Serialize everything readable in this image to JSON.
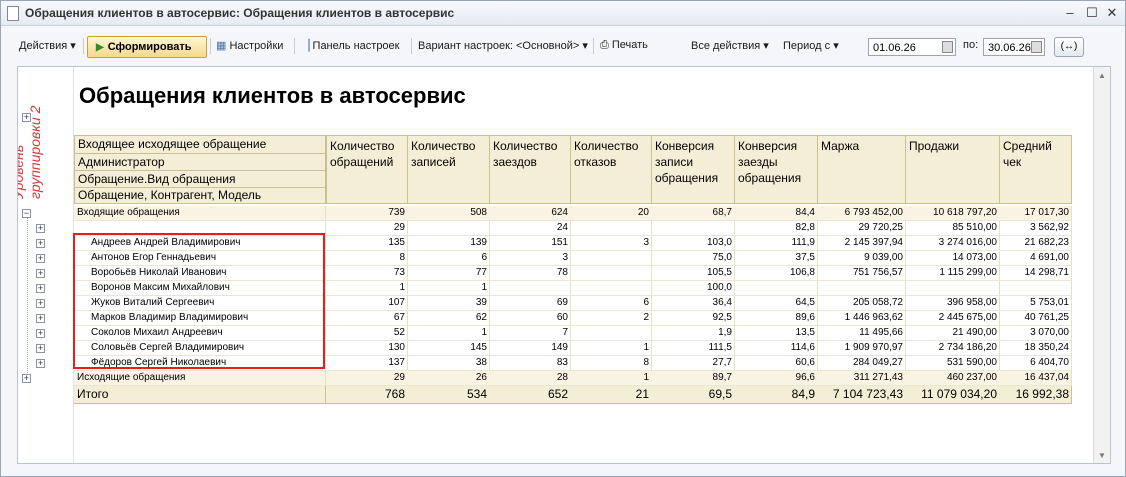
{
  "window": {
    "title": "Обращения клиентов в автосервис: Обращения клиентов в автосервис"
  },
  "toolbar": {
    "actions": "Действия",
    "form": "Сформировать",
    "settings": "Настройки",
    "panel": "Панель настроек",
    "variant": "Вариант настроек: <Основной>",
    "print": "Печать",
    "all_actions": "Все действия",
    "period": "Период с",
    "date_from": "01.06.26",
    "to": "по:",
    "date_to": "30.06.26"
  },
  "report": {
    "title": "Обращения клиентов в автосервис",
    "annotation_line1": "Уровень",
    "annotation_line2": "группировки 2",
    "row_headers": [
      "Входящее исходящее обращение",
      "Администратор",
      "Обращение.Вид обращения",
      "Обращение, Контрагент, Модель"
    ],
    "columns": [
      "Количество обращений",
      "Количество записей",
      "Количество заездов",
      "Количество отказов",
      "Конверсия записи обращения",
      "Конверсия заезды обращения",
      "Маржа",
      "Продажи",
      "Средний чек"
    ],
    "rows": [
      {
        "name": "Входящие обращения",
        "vals": [
          "739",
          "508",
          "624",
          "20",
          "68,7",
          "84,4",
          "6 793 452,00",
          "10 618 797,20",
          "17 017,30"
        ]
      },
      {
        "name": "",
        "vals": [
          "29",
          "",
          "24",
          "",
          "",
          "82,8",
          "29 720,25",
          "85 510,00",
          "3 562,92"
        ]
      },
      {
        "name": "Андреев Андрей Владимирович",
        "vals": [
          "135",
          "139",
          "151",
          "3",
          "103,0",
          "111,9",
          "2 145 397,94",
          "3 274 016,00",
          "21 682,23"
        ]
      },
      {
        "name": "Антонов Егор Геннадьевич",
        "vals": [
          "8",
          "6",
          "3",
          "",
          "75,0",
          "37,5",
          "9 039,00",
          "14 073,00",
          "4 691,00"
        ]
      },
      {
        "name": "Воробьёв Николай Иванович",
        "vals": [
          "73",
          "77",
          "78",
          "",
          "105,5",
          "106,8",
          "751 756,57",
          "1 115 299,00",
          "14 298,71"
        ]
      },
      {
        "name": "Воронов Максим Михайлович",
        "vals": [
          "1",
          "1",
          "",
          "",
          "100,0",
          "",
          "",
          "",
          ""
        ]
      },
      {
        "name": "Жуков Виталий Сергеевич",
        "vals": [
          "107",
          "39",
          "69",
          "6",
          "36,4",
          "64,5",
          "205 058,72",
          "396 958,00",
          "5 753,01"
        ]
      },
      {
        "name": "Марков Владимир Владимирович",
        "vals": [
          "67",
          "62",
          "60",
          "2",
          "92,5",
          "89,6",
          "1 446 963,62",
          "2 445 675,00",
          "40 761,25"
        ]
      },
      {
        "name": "Соколов Михаил Андреевич",
        "vals": [
          "52",
          "1",
          "7",
          "",
          "1,9",
          "13,5",
          "11 495,66",
          "21 490,00",
          "3 070,00"
        ]
      },
      {
        "name": "Соловьёв Сергей Владимирович",
        "vals": [
          "130",
          "145",
          "149",
          "1",
          "111,5",
          "114,6",
          "1 909 970,97",
          "2 734 186,20",
          "18 350,24"
        ]
      },
      {
        "name": "Фёдоров Сергей Николаевич",
        "vals": [
          "137",
          "38",
          "83",
          "8",
          "27,7",
          "60,6",
          "284 049,27",
          "531 590,00",
          "6 404,70"
        ]
      },
      {
        "name": "Исходящие обращения",
        "vals": [
          "29",
          "26",
          "28",
          "1",
          "89,7",
          "96,6",
          "311 271,43",
          "460 237,00",
          "16 437,04"
        ]
      }
    ],
    "total": {
      "name": "Итого",
      "vals": [
        "768",
        "534",
        "652",
        "21",
        "69,5",
        "84,9",
        "7 104 723,43",
        "11 079 034,20",
        "16 992,38"
      ]
    }
  }
}
